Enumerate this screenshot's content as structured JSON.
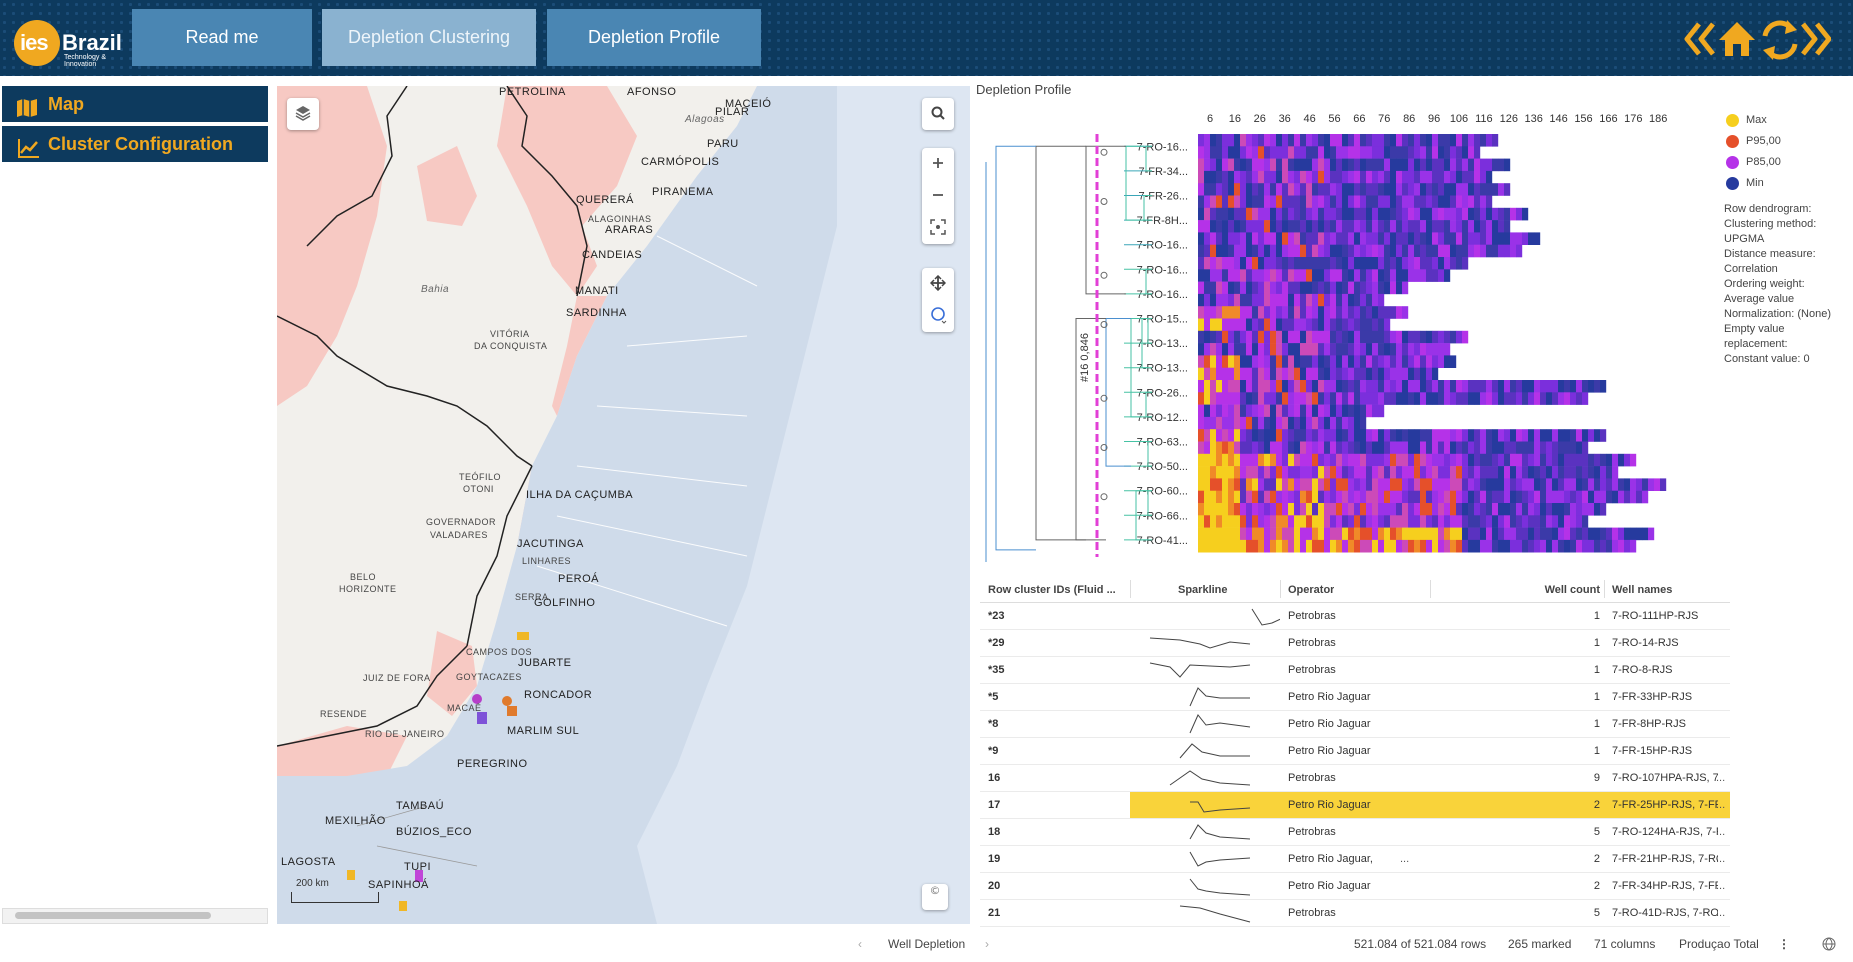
{
  "header": {
    "logo_text": "ies",
    "logo_brand": "Brazil",
    "logo_tagline": "Technology & Innovation",
    "tabs": [
      {
        "label": "Read me",
        "active": false
      },
      {
        "label": "Depletion Clustering",
        "active": true
      },
      {
        "label": "Depletion Profile",
        "active": false
      }
    ],
    "icons": [
      "back-icon",
      "home-icon",
      "refresh-icon"
    ]
  },
  "sidebar": {
    "items": [
      {
        "label": "Map",
        "icon": "map-icon"
      },
      {
        "label": "Cluster Configuration",
        "icon": "line-chart-icon"
      }
    ]
  },
  "map": {
    "scale_label": "200 km",
    "labels": {
      "petrolina": "PETROLINA",
      "afonso": "AFONSO",
      "maceio": "MACEIÓ",
      "pilar": "PILAR",
      "alagoas": "Alagoas",
      "paru": "PARU",
      "carmopolis": "CARMÓPOLIS",
      "piranema": "PIRANEMA",
      "querera": "QUERERÁ",
      "araras": "ARARAS",
      "alagoinhas": "ALAGOINHAS",
      "candeias": "CANDEIAS",
      "bahia": "Bahia",
      "manati": "MANATI",
      "sardinha": "SARDINHA",
      "vitoria_line1": "VITÓRIA",
      "vitoria_line2": "DA CONQUISTA",
      "teofilo1": "TEÓFILO",
      "teofilo2": "OTONI",
      "ilha": "ILHA DA CAÇUMBA",
      "gv1": "GOVERNADOR",
      "gv2": "VALADARES",
      "jacutinga": "JACUTINGA",
      "linhares": "LINHARES",
      "peroa": "PEROÁ",
      "golfinho": "GOLFINHO",
      "belo1": "BELO",
      "belo2": "HORIZONTE",
      "serra": "SERRA",
      "campos": "CAMPOS DOS",
      "goytacazes": "GOYTACAZES",
      "jubarte": "JUBARTE",
      "juiz": "JUIZ DE FORA",
      "roncador": "RONCADOR",
      "resende": "RESENDE",
      "macae": "MACAÉ",
      "marlim": "MARLIM SUL",
      "rio": "RIO DE JANEIRO",
      "peregrino": "PEREGRINO",
      "tambau": "TAMBAÚ",
      "mexilhao": "MEXILHÃO",
      "buzios": "BÚZIOS_ECO",
      "lagosta": "LAGOSTA",
      "tupi": "TUPI",
      "sapinhoa": "SAPINHOÁ"
    },
    "controls": [
      "layers-icon",
      "search-icon",
      "zoom-in-icon",
      "zoom-out-icon",
      "fit-extent-icon",
      "pan-icon",
      "lasso-icon",
      "copyright-icon"
    ]
  },
  "depletion": {
    "title": "Depletion Profile",
    "x_ticks": [
      "6",
      "16",
      "26",
      "36",
      "46",
      "56",
      "66",
      "76",
      "86",
      "96",
      "106",
      "116",
      "126",
      "136",
      "146",
      "156",
      "166",
      "176",
      "186"
    ],
    "row_labels": [
      "7-RO-16...",
      "7-FR-34...",
      "7-FR-26...",
      "7-FR-8H...",
      "7-RO-16...",
      "7-RO-16...",
      "7-RO-16...",
      "7-RO-15...",
      "7-RO-13...",
      "7-RO-13...",
      "7-RO-26...",
      "7-RO-12...",
      "7-RO-63...",
      "7-RO-50...",
      "7-RO-60...",
      "7-RO-66...",
      "7-RO-41..."
    ],
    "cut_label": "#16 0,846",
    "legend": [
      {
        "label": "Max",
        "color": "#f6cf1e"
      },
      {
        "label": "P95,00",
        "color": "#e5502a"
      },
      {
        "label": "P85,00",
        "color": "#b532e8"
      },
      {
        "label": "Min",
        "color": "#263a9e"
      }
    ],
    "info_lines": [
      "Row dendrogram:",
      "Clustering method:",
      "UPGMA",
      "Distance measure:",
      "Correlation",
      "Ordering weight:",
      "Average value",
      "Normalization: (None)",
      "Empty value",
      "replacement:",
      "Constant value: 0"
    ]
  },
  "table": {
    "headers": [
      "Row cluster IDs (Fluid ...",
      "Sparkline",
      "Operator",
      "Well count",
      "Well names"
    ],
    "rows": [
      {
        "id": "*23",
        "operator": "Petrobras",
        "count": "1",
        "names": "7-RO-111HP-RJS",
        "dots_op": "",
        "dots_names": "",
        "highlight": false
      },
      {
        "id": "*29",
        "operator": "Petrobras",
        "count": "1",
        "names": "7-RO-14-RJS",
        "dots_op": "",
        "dots_names": "",
        "highlight": false
      },
      {
        "id": "*35",
        "operator": "Petrobras",
        "count": "1",
        "names": "7-RO-8-RJS",
        "dots_op": "",
        "dots_names": "",
        "highlight": false
      },
      {
        "id": "*5",
        "operator": "Petro Rio Jaguar",
        "count": "1",
        "names": "7-FR-33HP-RJS",
        "dots_op": "",
        "dots_names": "",
        "highlight": false
      },
      {
        "id": "*8",
        "operator": "Petro Rio Jaguar",
        "count": "1",
        "names": "7-FR-8HP-RJS",
        "dots_op": "",
        "dots_names": "",
        "highlight": false
      },
      {
        "id": "*9",
        "operator": "Petro Rio Jaguar",
        "count": "1",
        "names": "7-FR-15HP-RJS",
        "dots_op": "",
        "dots_names": "",
        "highlight": false
      },
      {
        "id": "16",
        "operator": "Petrobras",
        "count": "9",
        "names": "7-RO-107HPA-RJS, 7-RO-",
        "dots_op": "",
        "dots_names": "...",
        "highlight": false
      },
      {
        "id": "17",
        "operator": "Petro Rio Jaguar",
        "count": "2",
        "names": "7-FR-25HP-RJS, 7-FR-",
        "dots_op": "",
        "dots_names": "...",
        "highlight": true
      },
      {
        "id": "18",
        "operator": "Petrobras",
        "count": "5",
        "names": "7-RO-124HA-RJS, 7-RO-",
        "dots_op": "",
        "dots_names": "...",
        "highlight": false
      },
      {
        "id": "19",
        "operator": "Petro Rio Jaguar,",
        "count": "2",
        "names": "7-FR-21HP-RJS, 7-RO-",
        "dots_op": "...",
        "dots_names": "...",
        "highlight": false
      },
      {
        "id": "20",
        "operator": "Petro Rio Jaguar",
        "count": "2",
        "names": "7-FR-34HP-RJS, 7-FR-",
        "dots_op": "",
        "dots_names": "...",
        "highlight": false
      },
      {
        "id": "21",
        "operator": "Petrobras",
        "count": "5",
        "names": "7-RO-41D-RJS, 7-RO-",
        "dots_op": "",
        "dots_names": "...",
        "highlight": false
      }
    ]
  },
  "status": {
    "page_name": "Well Depletion",
    "rows": "521.084 of 521.084 rows",
    "marked": "265 marked",
    "columns": "71 columns",
    "measure": "Produçao Total"
  }
}
